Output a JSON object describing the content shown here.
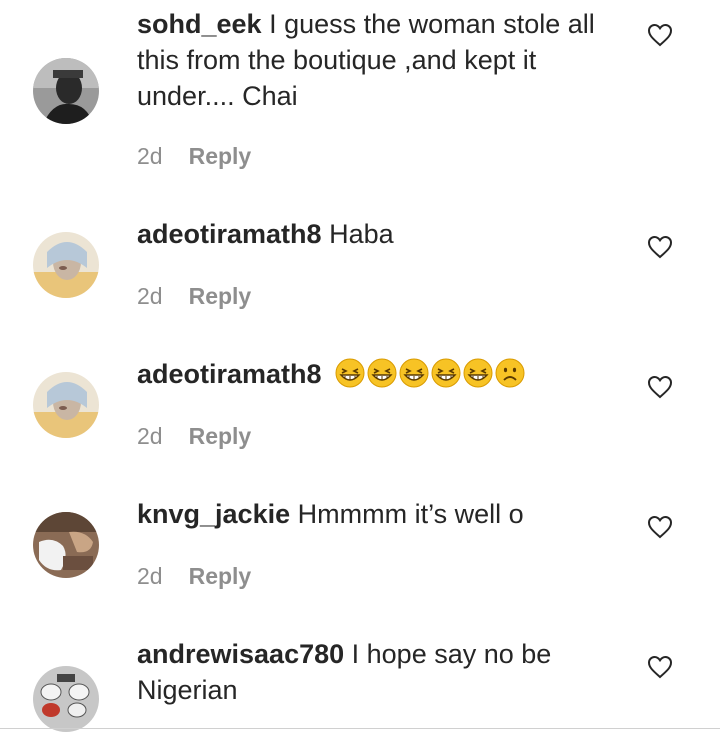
{
  "comments": [
    {
      "username": "sohd_eek",
      "text": " I guess the woman stole all this from the boutique ,and kept it under.... Chai",
      "time": "2d",
      "reply": "Reply",
      "avatar_icon": "person-photo-bw"
    },
    {
      "username": "adeotiramath8",
      "text": " Haba",
      "time": "2d",
      "reply": "Reply",
      "avatar_icon": "person-photo-pastel"
    },
    {
      "username": "adeotiramath8",
      "text": "",
      "emojis": [
        "grinning-squinting-face",
        "grinning-squinting-face",
        "grinning-squinting-face",
        "grinning-squinting-face",
        "grinning-squinting-face",
        "frowning-face"
      ],
      "time": "2d",
      "reply": "Reply",
      "avatar_icon": "person-photo-pastel"
    },
    {
      "username": "knvg_jackie",
      "text": " Hmmmm it’s well o",
      "time": "2d",
      "reply": "Reply",
      "avatar_icon": "photo-hands"
    },
    {
      "username": "andrewisaac780",
      "text": " I hope say no be Nigerian",
      "avatar_icon": "photo-sneakers"
    }
  ],
  "icons": {
    "like": "heart-outline-icon"
  },
  "colors": {
    "text": "#262626",
    "muted": "#8e8e8e",
    "background": "#ffffff",
    "emoji": "#f7c325"
  }
}
